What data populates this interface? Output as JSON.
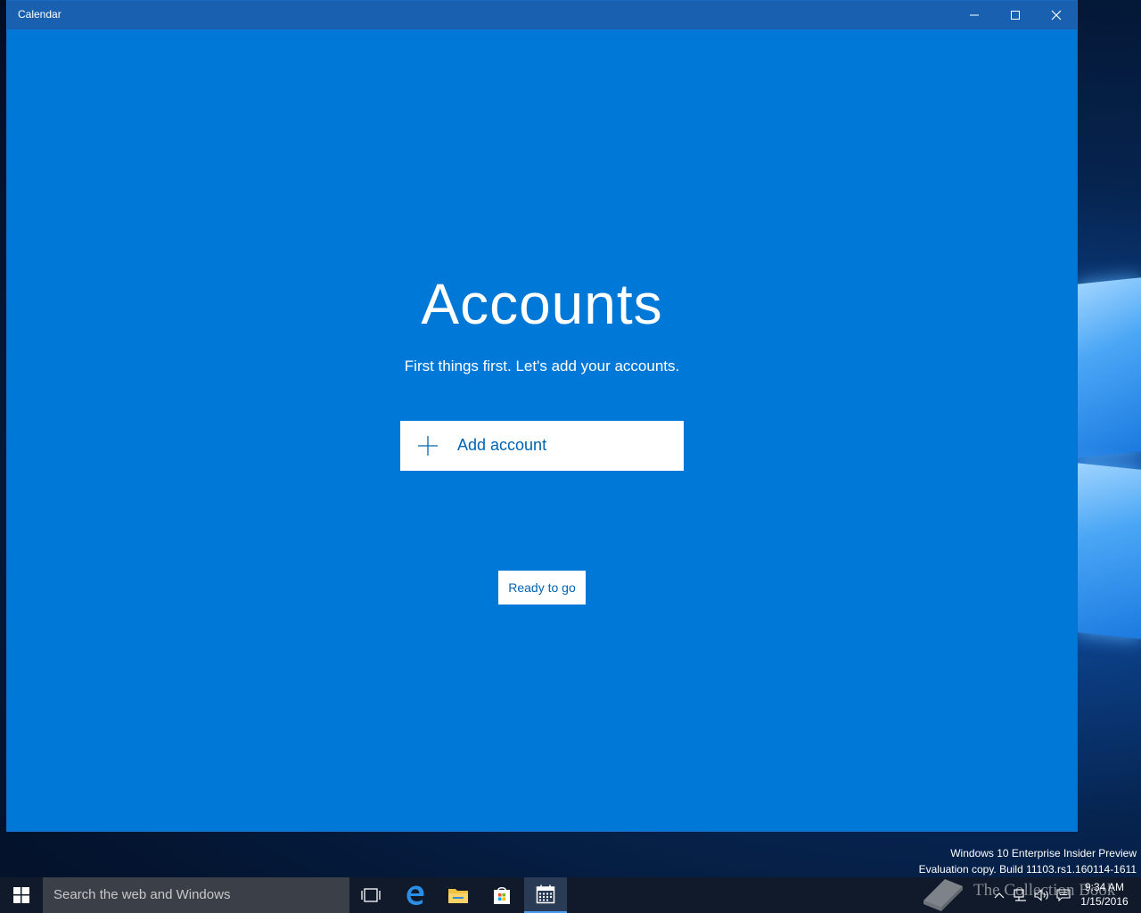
{
  "window": {
    "title": "Calendar"
  },
  "main": {
    "heading": "Accounts",
    "subheading": "First things first. Let's add your accounts.",
    "add_account_label": "Add account",
    "ready_label": "Ready to go"
  },
  "desktop": {
    "watermark_line1": "Windows 10 Enterprise Insider Preview",
    "watermark_line2": "Evaluation copy. Build 11103.rs1.160114-1611",
    "brand_text": "The Collection Book"
  },
  "taskbar": {
    "search_placeholder": "Search the web and Windows",
    "time": "9:34 AM",
    "date": "1/15/2016"
  },
  "colors": {
    "app_background": "#0078d7",
    "titlebar": "#1960b0",
    "accent_text": "#0063b1",
    "taskbar": "#101a2a"
  }
}
